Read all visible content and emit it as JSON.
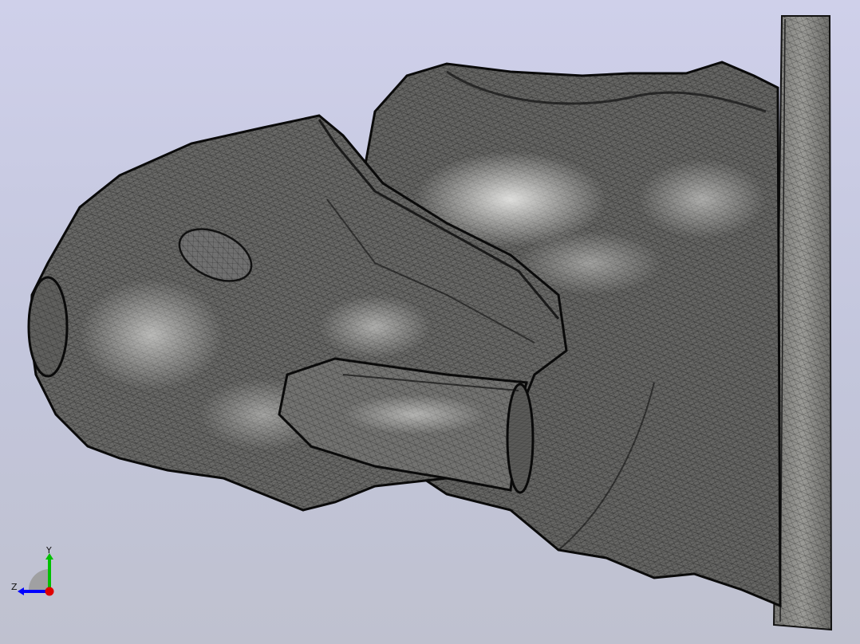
{
  "viewport": {
    "background_top": "#cfd0ea",
    "background_bottom": "#bfc1cf",
    "model_fill": "#6a6a68",
    "mesh_color": "#1a1a1a"
  },
  "triad": {
    "y_label": "Y",
    "z_label": "Z",
    "x_color": "#e00000",
    "y_color": "#00c000",
    "z_color": "#0000ff"
  }
}
